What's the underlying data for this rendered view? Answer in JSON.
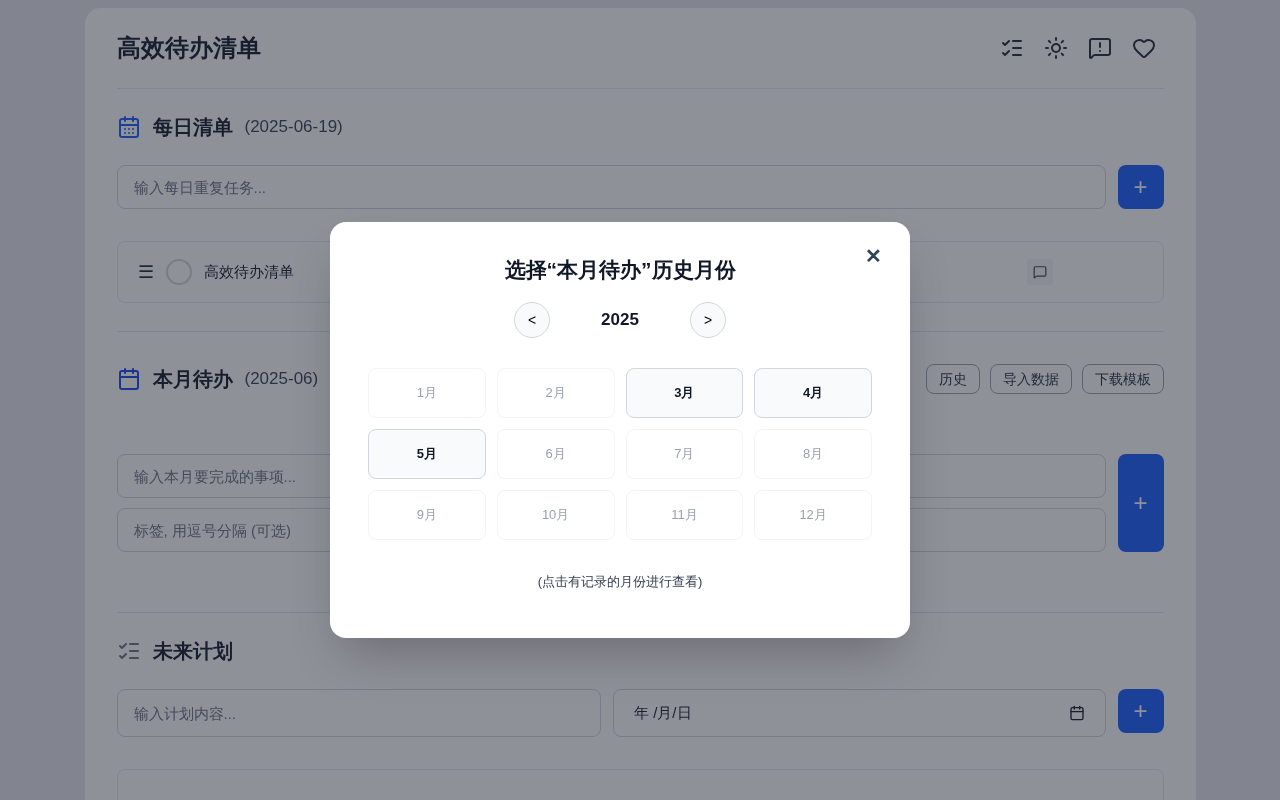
{
  "app": {
    "title": "高效待办清单"
  },
  "daily": {
    "title": "每日清单",
    "date": "(2025-06-19)",
    "input": {
      "placeholder": "输入每日重复任务..."
    },
    "add_button": "+",
    "items": [
      {
        "menu": "☰",
        "text": "高效待办清单",
        "checked": false
      }
    ]
  },
  "monthly": {
    "title": "本月待办",
    "date": "(2025-06)",
    "buttons": [
      "历史",
      "导入数据",
      "下载模板"
    ],
    "task_input": {
      "placeholder": "输入本月要完成的事项..."
    },
    "tags_input": {
      "placeholder": "标签, 用逗号分隔 (可选)"
    },
    "add_button": "+"
  },
  "future": {
    "title": "未来计划",
    "content_input": {
      "placeholder": "输入计划内容..."
    },
    "date_input": {
      "value": "年 /月/日"
    },
    "add_button": "+"
  },
  "dialog": {
    "title": "选择“本月待办”历史月份",
    "close": "✕",
    "prev": "<",
    "year": "2025",
    "next": ">",
    "months": [
      {
        "label": "1月",
        "has_record": false
      },
      {
        "label": "2月",
        "has_record": false
      },
      {
        "label": "3月",
        "has_record": true
      },
      {
        "label": "4月",
        "has_record": true
      },
      {
        "label": "5月",
        "has_record": true
      },
      {
        "label": "6月",
        "has_record": false
      },
      {
        "label": "7月",
        "has_record": false
      },
      {
        "label": "8月",
        "has_record": false
      },
      {
        "label": "9月",
        "has_record": false
      },
      {
        "label": "10月",
        "has_record": false
      },
      {
        "label": "11月",
        "has_record": false
      },
      {
        "label": "12月",
        "has_record": false
      }
    ],
    "hint": "(点击有记录的月份进行查看)"
  }
}
